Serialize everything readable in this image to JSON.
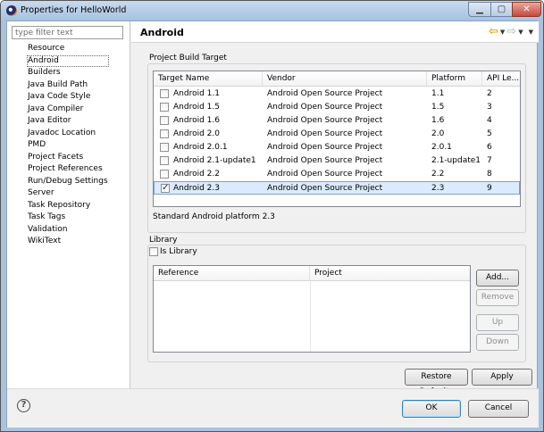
{
  "window": {
    "title": "Properties for HelloWorld"
  },
  "filter": {
    "placeholder": "type filter text"
  },
  "nav": {
    "items": [
      "Resource",
      "Android",
      "Builders",
      "Java Build Path",
      "Java Code Style",
      "Java Compiler",
      "Java Editor",
      "Javadoc Location",
      "PMD",
      "Project Facets",
      "Project References",
      "Run/Debug Settings",
      "Server",
      "Task Repository",
      "Task Tags",
      "Validation",
      "WikiText"
    ],
    "selected": "Android"
  },
  "page": {
    "title": "Android"
  },
  "build_target": {
    "section_label": "Project Build Target",
    "columns": [
      "Target Name",
      "Vendor",
      "Platform",
      "API Le..."
    ],
    "rows": [
      {
        "name": "Android 1.1",
        "vendor": "Android Open Source Project",
        "platform": "1.1",
        "api": "2",
        "checked": false
      },
      {
        "name": "Android 1.5",
        "vendor": "Android Open Source Project",
        "platform": "1.5",
        "api": "3",
        "checked": false
      },
      {
        "name": "Android 1.6",
        "vendor": "Android Open Source Project",
        "platform": "1.6",
        "api": "4",
        "checked": false
      },
      {
        "name": "Android 2.0",
        "vendor": "Android Open Source Project",
        "platform": "2.0",
        "api": "5",
        "checked": false
      },
      {
        "name": "Android 2.0.1",
        "vendor": "Android Open Source Project",
        "platform": "2.0.1",
        "api": "6",
        "checked": false
      },
      {
        "name": "Android 2.1-update1",
        "vendor": "Android Open Source Project",
        "platform": "2.1-update1",
        "api": "7",
        "checked": false
      },
      {
        "name": "Android 2.2",
        "vendor": "Android Open Source Project",
        "platform": "2.2",
        "api": "8",
        "checked": false
      },
      {
        "name": "Android 2.3",
        "vendor": "Android Open Source Project",
        "platform": "2.3",
        "api": "9",
        "checked": true
      }
    ],
    "description": "Standard Android platform 2.3"
  },
  "library": {
    "section_label": "Library",
    "is_library_label": "Is Library",
    "is_library_checked": false,
    "columns": [
      "Reference",
      "Project"
    ],
    "buttons": {
      "add": "Add...",
      "remove": "Remove",
      "up": "Up",
      "down": "Down"
    }
  },
  "actions": {
    "restore_defaults": "Restore Defaults",
    "apply": "Apply",
    "ok": "OK",
    "cancel": "Cancel",
    "help_glyph": "?"
  },
  "icons": {
    "back": "back-arrow-icon",
    "forward": "forward-arrow-icon",
    "menu": "view-menu-icon",
    "help": "help-icon"
  },
  "colors": {
    "selection_bg": "#dbeafc",
    "selection_border": "#7da2ce",
    "titlebar": "#a7c2df",
    "close_button": "#c74a39"
  }
}
